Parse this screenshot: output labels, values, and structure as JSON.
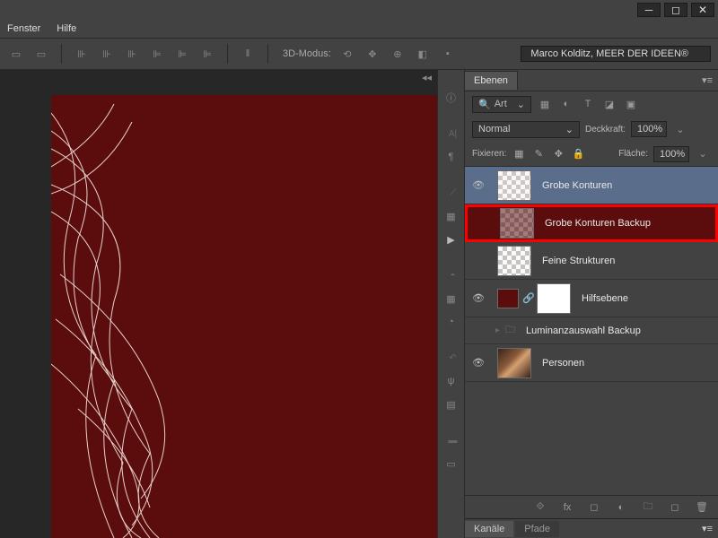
{
  "menu": {
    "fenster": "Fenster",
    "hilfe": "Hilfe"
  },
  "optbar": {
    "mode_label": "3D-Modus:",
    "brand": "Marco Kolditz, MEER DER IDEEN®"
  },
  "panel": {
    "tab_layers": "Ebenen",
    "search_label": "Art",
    "blend_mode": "Normal",
    "opacity_label": "Deckkraft:",
    "opacity_value": "100%",
    "fill_label": "Fläche:",
    "fill_value": "100%",
    "lock_label": "Fixieren:"
  },
  "layers": [
    {
      "name": "Grobe Konturen",
      "visible": true,
      "selected": true
    },
    {
      "name": "Grobe Konturen Backup",
      "visible": false,
      "highlighted": true
    },
    {
      "name": "Feine Strukturen",
      "visible": false
    },
    {
      "name": "Hilfsebene",
      "visible": true,
      "masked": true
    },
    {
      "name": "Luminanzauswahl Backup",
      "visible": false,
      "group": true
    },
    {
      "name": "Personen",
      "visible": true,
      "image": true
    }
  ],
  "bottom_tabs": {
    "kanale": "Kanäle",
    "pfade": "Pfade"
  },
  "icons": {
    "eye": "👁",
    "lock": "🔒",
    "link": "🔗",
    "fx": "fx"
  }
}
